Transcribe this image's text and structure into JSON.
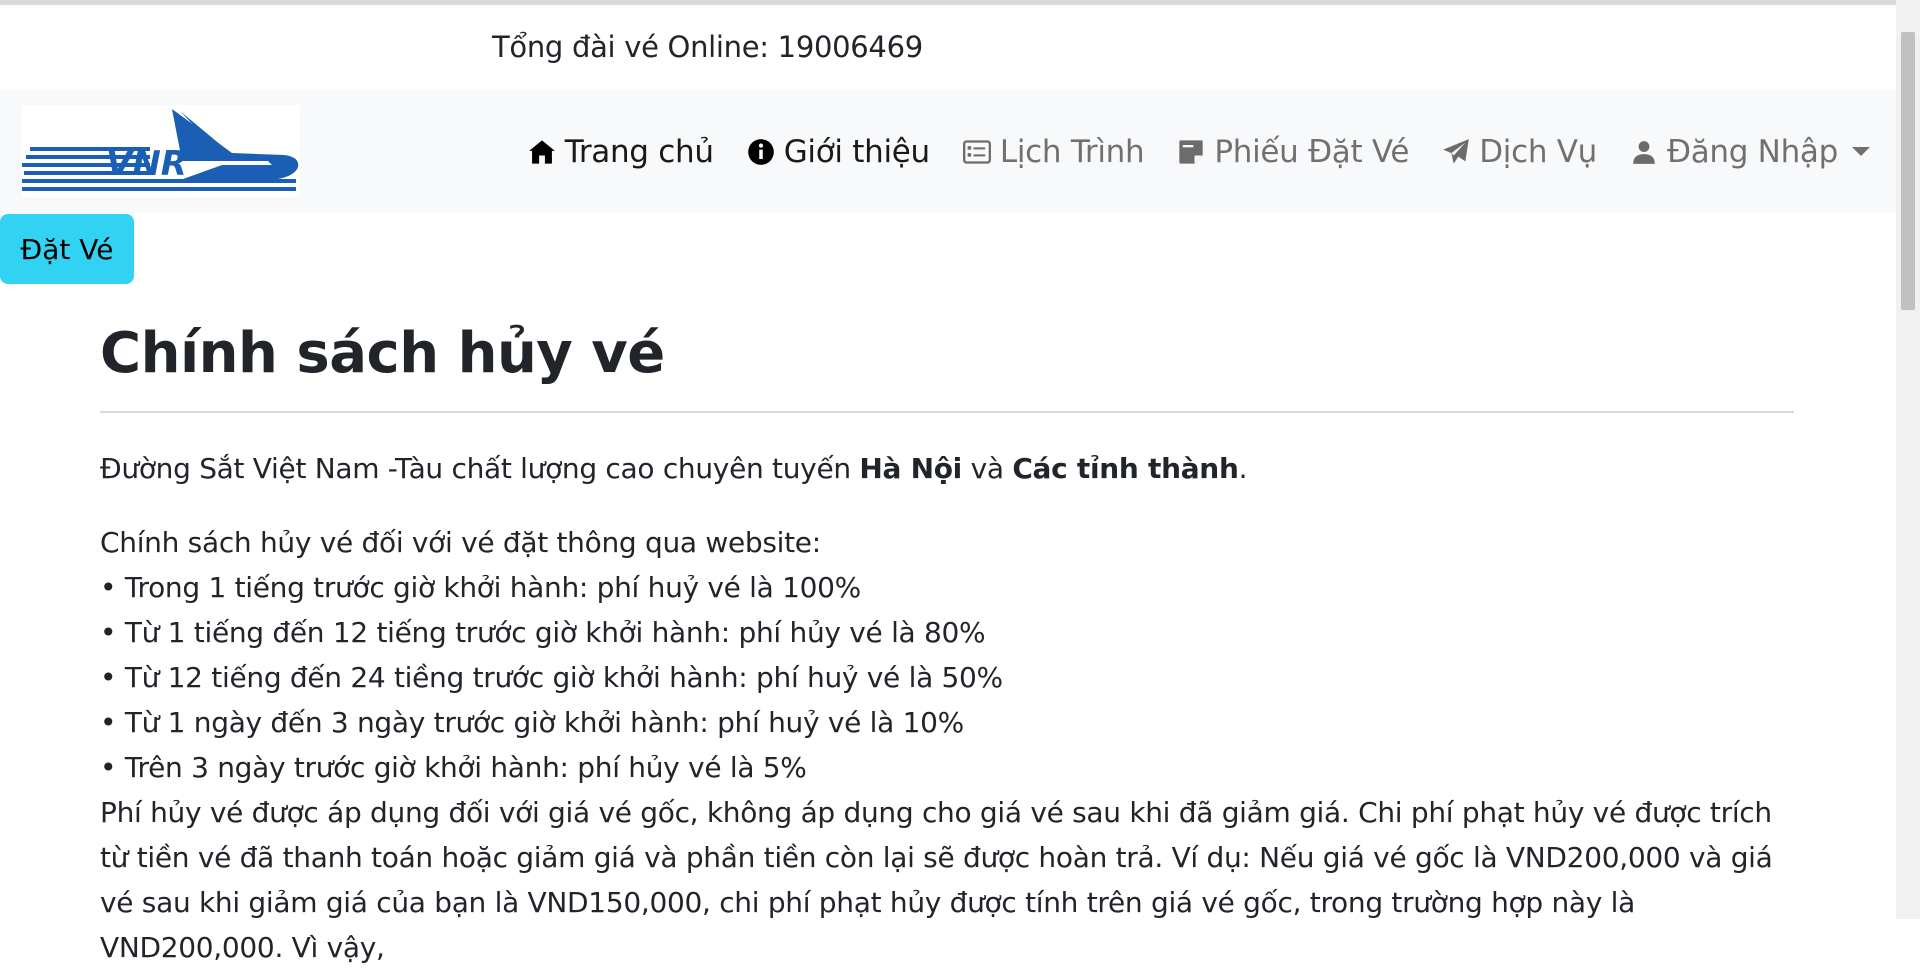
{
  "hotline": "Tổng đài vé Online: 19006469",
  "brand": {
    "logo_text": "VNR"
  },
  "nav": [
    {
      "label": "Trang chủ",
      "icon": "home-icon",
      "active": true
    },
    {
      "label": "Giới thiệu",
      "icon": "info-icon",
      "active": true
    },
    {
      "label": "Lịch Trình",
      "icon": "schedule-icon",
      "active": false
    },
    {
      "label": "Phiếu Đặt Vé",
      "icon": "ticket-icon",
      "active": false
    },
    {
      "label": "Dịch Vụ",
      "icon": "send-icon",
      "active": false
    },
    {
      "label": "Đăng Nhập",
      "icon": "user-icon",
      "active": false
    }
  ],
  "book_button": "Đặt Vé",
  "page": {
    "title": "Chính sách hủy vé",
    "intro_1": "Đường Sắt Việt Nam -Tàu chất lượng cao chuyên tuyến ",
    "intro_bold_1": "Hà Nội",
    "intro_2": " và ",
    "intro_bold_2": "Các tỉnh thành",
    "intro_3": ".",
    "policy_heading": "Chính sách hủy vé đối với vé đặt thông qua website:",
    "rules": [
      "• Trong 1 tiếng trước giờ khởi hành: phí huỷ vé là 100%",
      "• Từ 1 tiếng đến 12 tiếng trước giờ khởi hành: phí hủy vé là 80%",
      "• Từ 12 tiếng đến 24 tiềng trước giờ khởi hành: phí huỷ vé là 50%",
      "• Từ 1 ngày đến 3 ngày trước giờ khởi hành: phí huỷ vé là 10%",
      "• Trên 3 ngày trước giờ khởi hành: phí hủy vé là 5%"
    ],
    "note": "Phí hủy vé được áp dụng đối với giá vé gốc, không áp dụng cho giá vé sau khi đã giảm giá. Chi phí phạt hủy vé được trích từ tiền vé đã thanh toán hoặc giảm giá và phần tiền còn lại sẽ được hoàn trả. Ví dụ: Nếu giá vé gốc là VND200,000 và giá vé sau khi giảm giá của bạn là VND150,000, chi phí phạt hủy được tính trên giá vé gốc, trong trường hợp này là VND200,000. Vì vậy,"
  },
  "colors": {
    "accent_button": "#31d2f2",
    "navbar_bg": "#f8f9fa",
    "logo_blue": "#1a5fb4"
  }
}
